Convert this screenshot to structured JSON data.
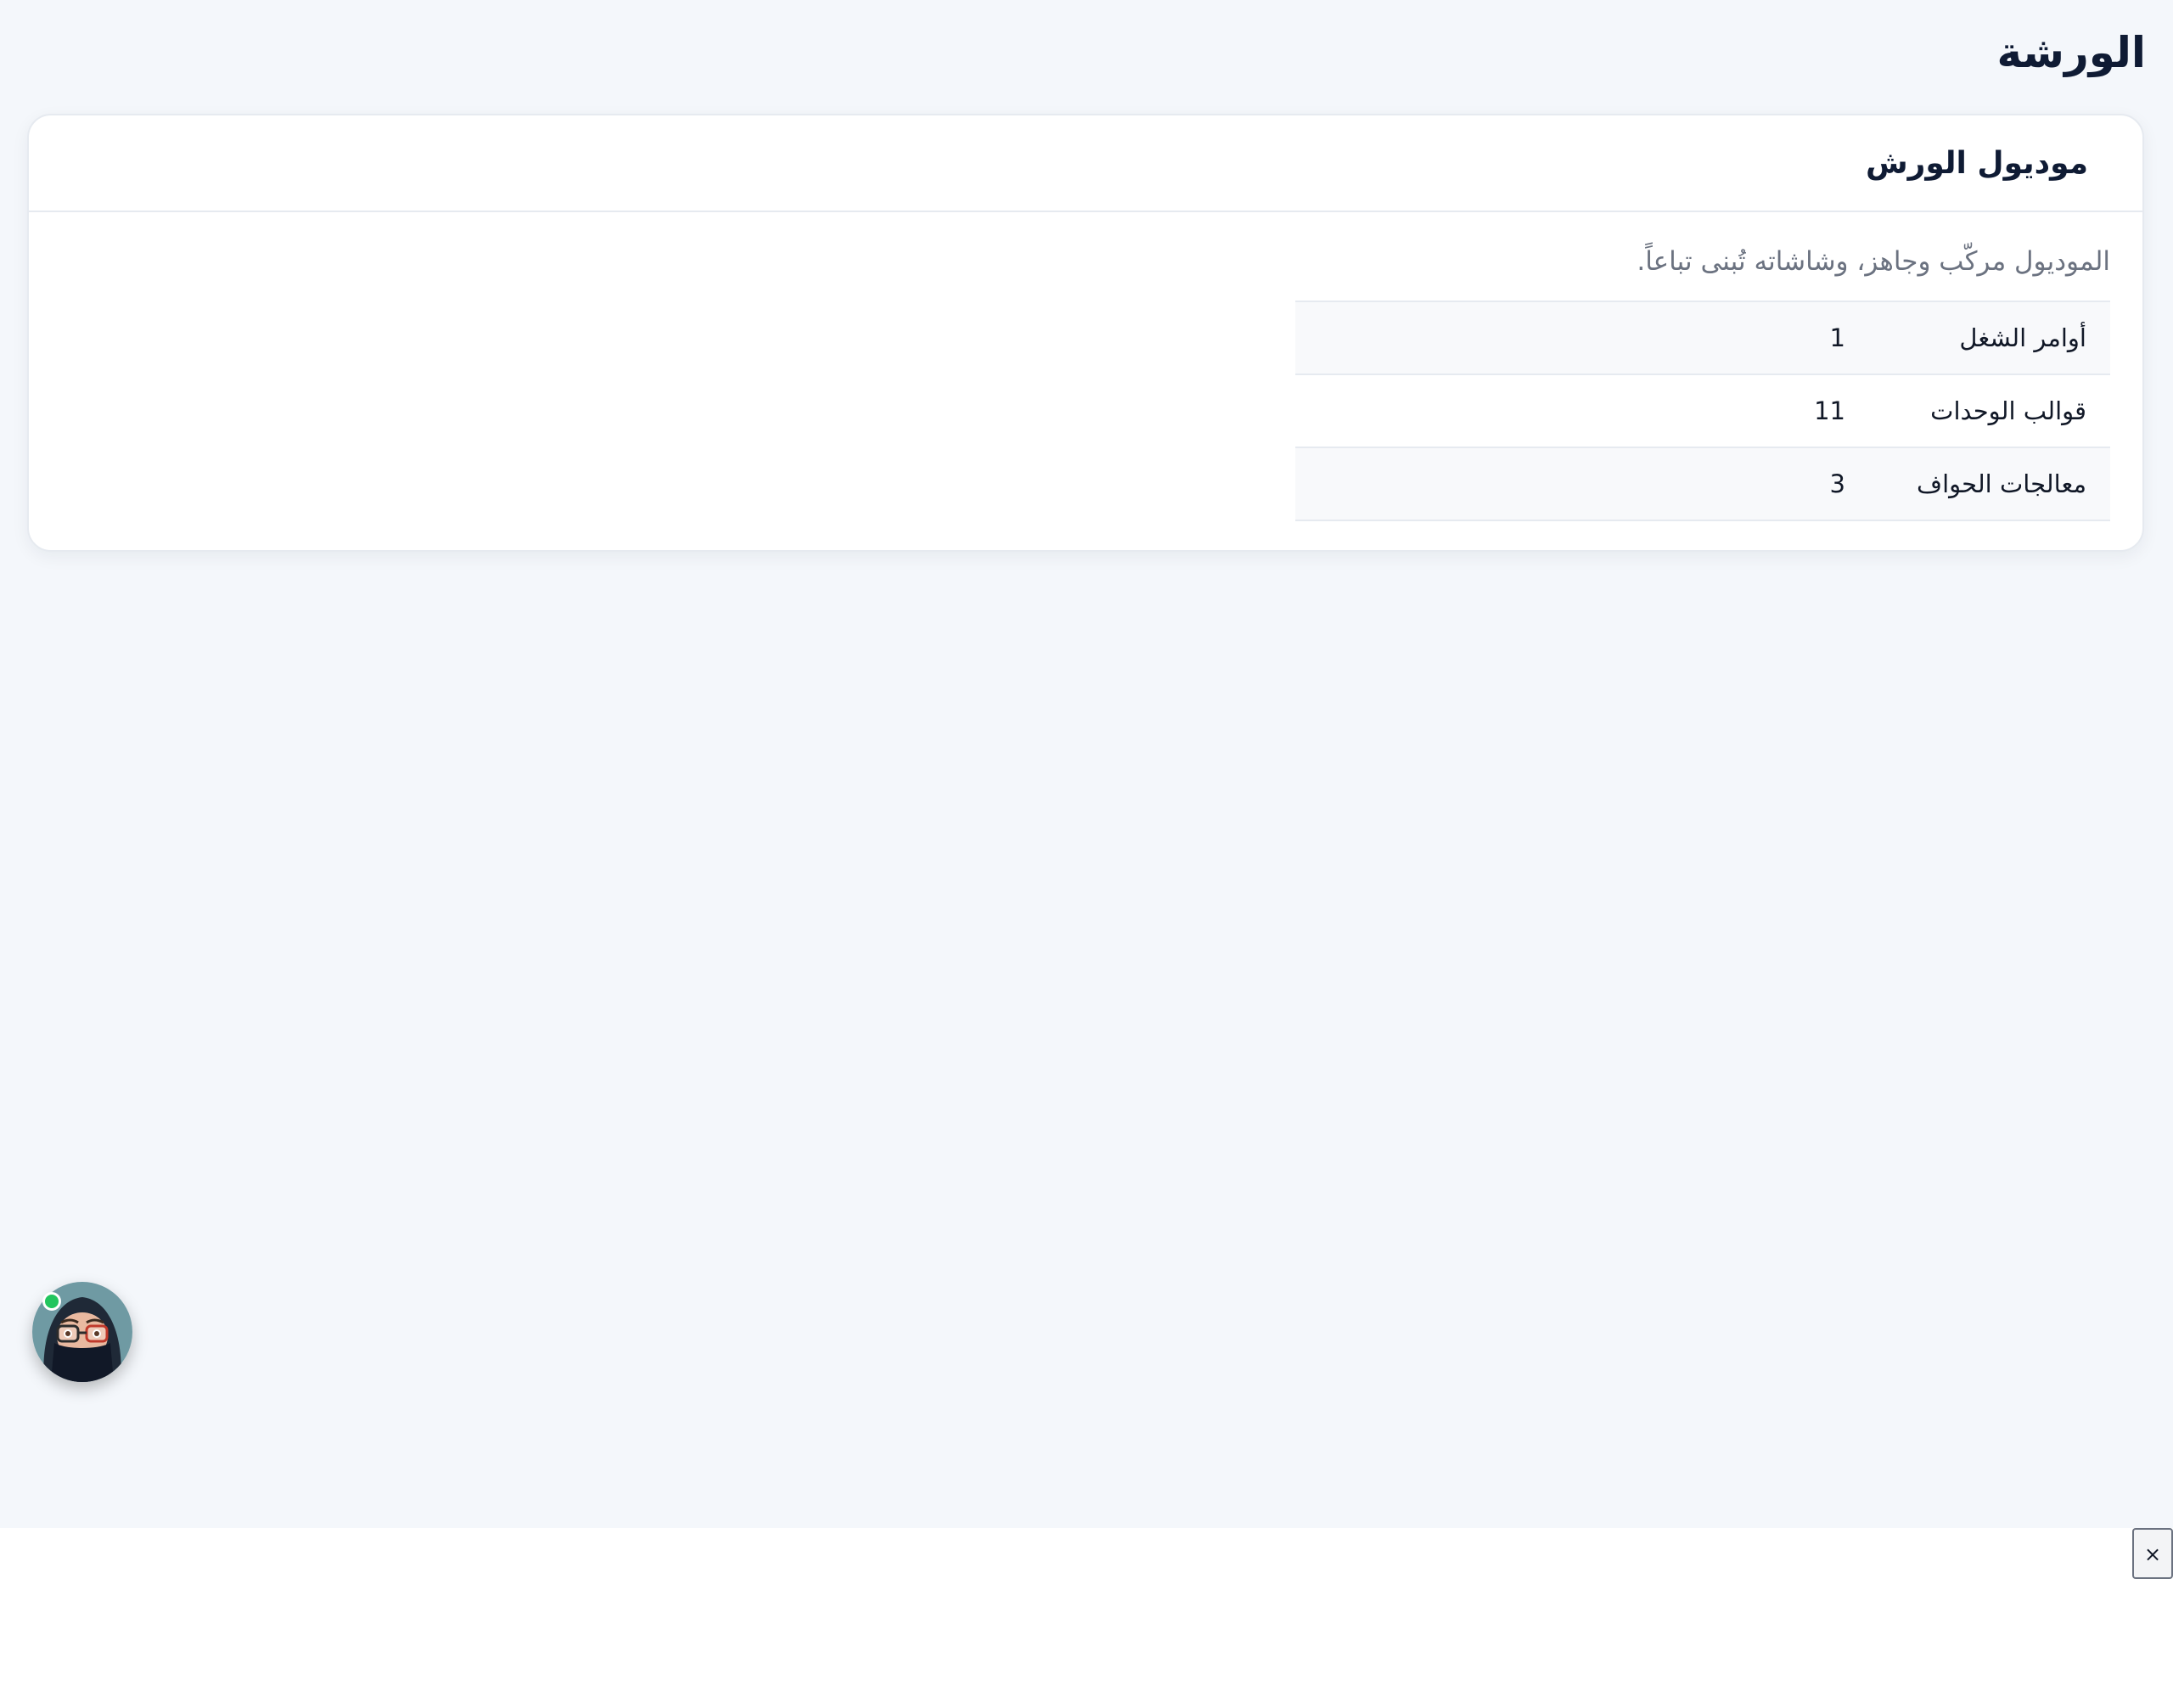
{
  "page": {
    "title": "الورشة"
  },
  "card": {
    "title": "موديول الورش",
    "description": "الموديول مركّب وجاهز، وشاشاته تُبنى تباعاً.",
    "rows": [
      {
        "label": "أوامر الشغل",
        "value": "1"
      },
      {
        "label": "قوالب الوحدات",
        "value": "11"
      },
      {
        "label": "معالجات الحواف",
        "value": "3"
      }
    ]
  },
  "assistant": {
    "icon": "assistant-avatar-icon",
    "status": "online",
    "status_color": "#22c55e"
  },
  "close_button": {
    "label": "×"
  },
  "colors": {
    "background": "#f4f7fb",
    "card": "#ffffff",
    "title": "#0f1b34",
    "muted": "#6b7280",
    "border": "#e6eaf0"
  }
}
